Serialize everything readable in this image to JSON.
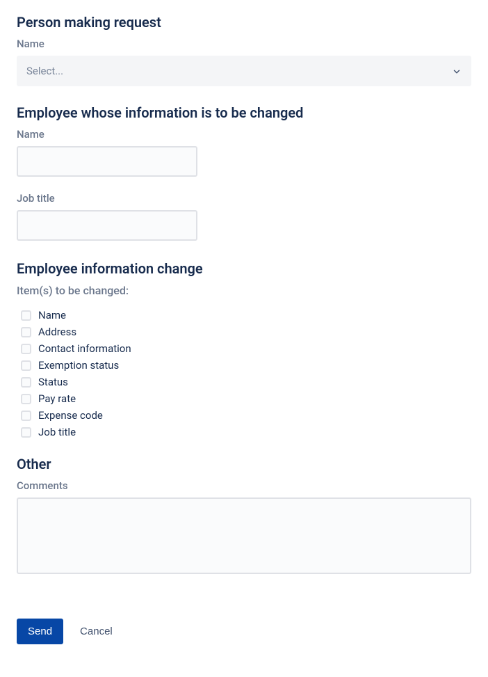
{
  "section1": {
    "heading": "Person making request",
    "name_label": "Name",
    "select_placeholder": "Select..."
  },
  "section2": {
    "heading": "Employee whose information is to be changed",
    "name_label": "Name",
    "name_value": "",
    "jobtitle_label": "Job title",
    "jobtitle_value": ""
  },
  "section3": {
    "heading": "Employee information change",
    "items_label": "Item(s) to be changed:",
    "items": [
      {
        "label": "Name"
      },
      {
        "label": "Address"
      },
      {
        "label": "Contact information"
      },
      {
        "label": "Exemption status"
      },
      {
        "label": "Status"
      },
      {
        "label": "Pay rate"
      },
      {
        "label": "Expense code"
      },
      {
        "label": "Job title"
      }
    ]
  },
  "section4": {
    "heading": "Other",
    "comments_label": "Comments",
    "comments_value": ""
  },
  "buttons": {
    "send": "Send",
    "cancel": "Cancel"
  }
}
